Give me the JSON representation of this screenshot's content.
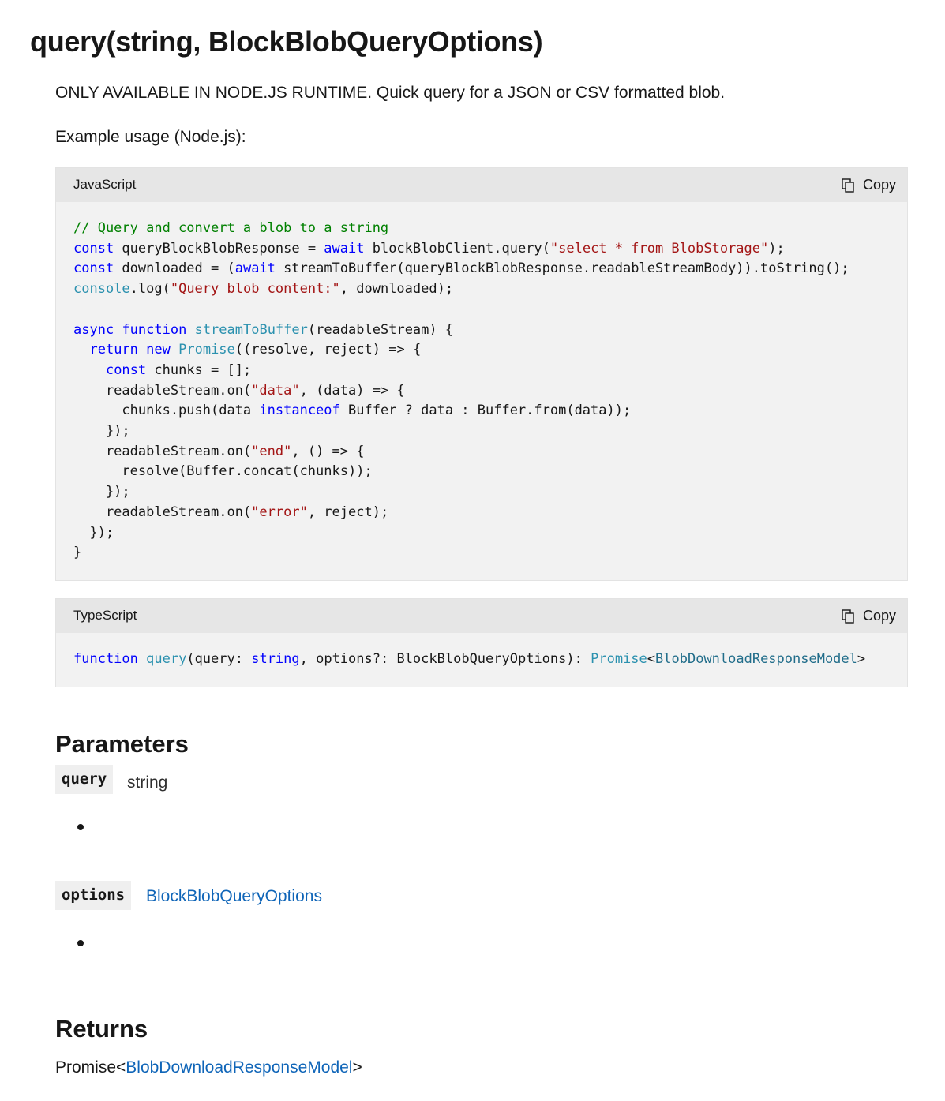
{
  "title": "query(string, BlockBlobQueryOptions)",
  "description": "ONLY AVAILABLE IN NODE.JS RUNTIME. Quick query for a JSON or CSV formatted blob.",
  "example_label": "Example usage (Node.js):",
  "code_blocks": [
    {
      "language": "JavaScript",
      "copy_label": "Copy",
      "lines": [
        "// Query and convert a blob to a string",
        "const queryBlockBlobResponse = await blockBlobClient.query(\"select * from BlobStorage\");",
        "const downloaded = (await streamToBuffer(queryBlockBlobResponse.readableStreamBody)).toString();",
        "console.log(\"Query blob content:\", downloaded);",
        "",
        "async function streamToBuffer(readableStream) {",
        "  return new Promise((resolve, reject) => {",
        "    const chunks = [];",
        "    readableStream.on(\"data\", (data) => {",
        "      chunks.push(data instanceof Buffer ? data : Buffer.from(data));",
        "    });",
        "    readableStream.on(\"end\", () => {",
        "      resolve(Buffer.concat(chunks));",
        "    });",
        "    readableStream.on(\"error\", reject);",
        "  });",
        "}"
      ]
    },
    {
      "language": "TypeScript",
      "copy_label": "Copy",
      "lines": [
        "function query(query: string, options?: BlockBlobQueryOptions): Promise<BlobDownloadResponseModel>"
      ]
    }
  ],
  "parameters_heading": "Parameters",
  "parameters": [
    {
      "name": "query",
      "type": "string",
      "type_is_link": false
    },
    {
      "name": "options",
      "type": "BlockBlobQueryOptions",
      "type_is_link": true
    }
  ],
  "returns_heading": "Returns",
  "returns": {
    "prefix": "Promise<",
    "type": "BlobDownloadResponseModel",
    "suffix": ">"
  },
  "colors": {
    "link": "#0f65b8",
    "keyword": "#0101fd",
    "comment": "#008000",
    "string": "#a31515",
    "type": "#2b91af"
  },
  "icons": {
    "copy": "copy-icon"
  }
}
